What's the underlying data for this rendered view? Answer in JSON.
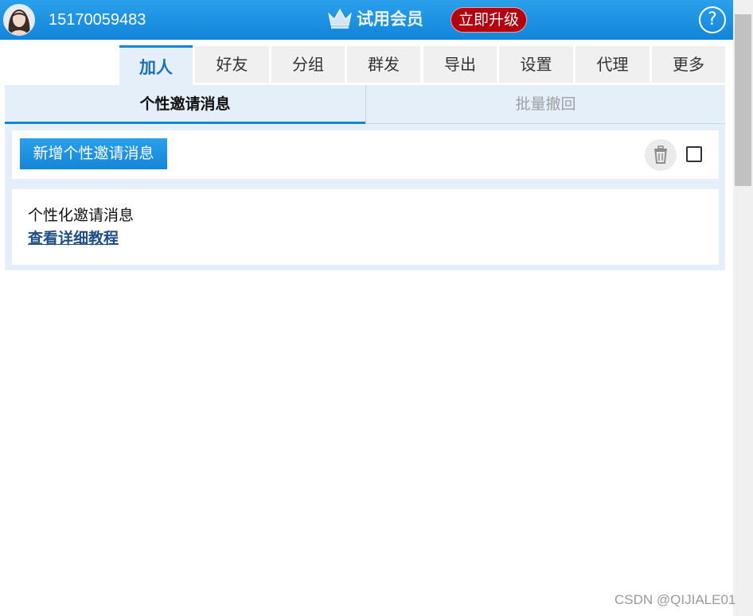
{
  "header": {
    "phone": "15170059483",
    "member_label": "试用会员",
    "upgrade_label": "立即升级",
    "help_label": "?"
  },
  "tabs": [
    {
      "label": "加人",
      "active": true
    },
    {
      "label": "好友",
      "active": false
    },
    {
      "label": "分组",
      "active": false
    },
    {
      "label": "群发",
      "active": false
    },
    {
      "label": "导出",
      "active": false
    },
    {
      "label": "设置",
      "active": false
    },
    {
      "label": "代理",
      "active": false
    },
    {
      "label": "更多",
      "active": false
    }
  ],
  "subtabs": [
    {
      "label": "个性邀请消息",
      "active": true
    },
    {
      "label": "批量撤回",
      "active": false
    }
  ],
  "toolbar": {
    "add_label": "新增个性邀请消息"
  },
  "card": {
    "text": "个性化邀请消息",
    "link": "查看详细教程"
  },
  "watermark": "CSDN @QIJIALE01",
  "colors": {
    "header_blue": "#1285d9",
    "accent_blue": "#1085da",
    "upgrade_red": "#b5000d",
    "panel_bg": "#e4effa"
  },
  "icons": {
    "crown": "crown-icon",
    "trash": "trash-icon",
    "help": "help-icon"
  }
}
